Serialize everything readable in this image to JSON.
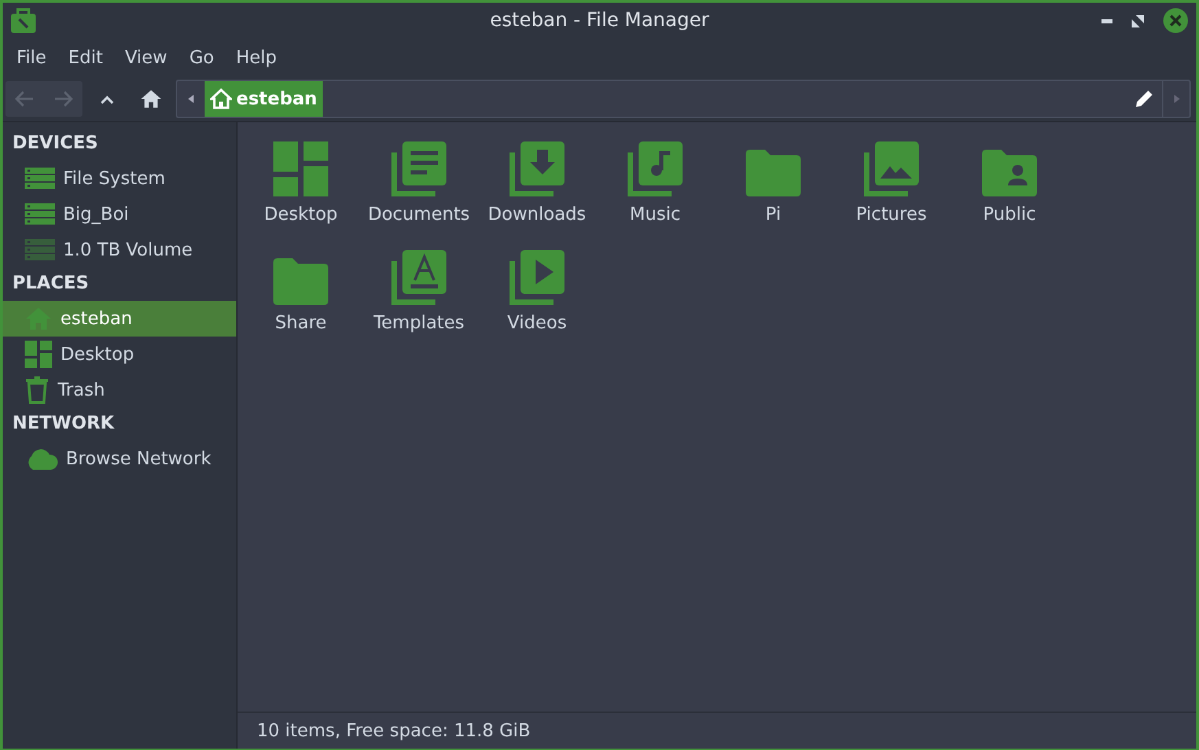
{
  "window": {
    "title": "esteban - File Manager"
  },
  "menu": [
    "File",
    "Edit",
    "View",
    "Go",
    "Help"
  ],
  "toolbar": {
    "back_disabled": true,
    "forward_disabled": true
  },
  "path": {
    "crumbs": [
      {
        "label": "esteban",
        "selected": true
      }
    ]
  },
  "sidebar": {
    "sections": [
      {
        "title": "DEVICES",
        "items": [
          {
            "label": "File System",
            "kind": "drive",
            "mounted": true,
            "selected": false
          },
          {
            "label": "Big_Boi",
            "kind": "drive",
            "mounted": true,
            "selected": false
          },
          {
            "label": "1.0 TB Volume",
            "kind": "drive",
            "mounted": false,
            "selected": false
          }
        ]
      },
      {
        "title": "PLACES",
        "items": [
          {
            "label": "esteban",
            "kind": "home",
            "selected": true
          },
          {
            "label": "Desktop",
            "kind": "desktop",
            "selected": false
          },
          {
            "label": "Trash",
            "kind": "trash",
            "selected": false
          }
        ]
      },
      {
        "title": "NETWORK",
        "items": [
          {
            "label": "Browse Network",
            "kind": "cloud",
            "selected": false
          }
        ]
      }
    ]
  },
  "files": [
    {
      "name": "Desktop",
      "kind": "desktop"
    },
    {
      "name": "Documents",
      "kind": "documents"
    },
    {
      "name": "Downloads",
      "kind": "downloads"
    },
    {
      "name": "Music",
      "kind": "music"
    },
    {
      "name": "Pi",
      "kind": "folder"
    },
    {
      "name": "Pictures",
      "kind": "pictures"
    },
    {
      "name": "Public",
      "kind": "public"
    },
    {
      "name": "Share",
      "kind": "folder"
    },
    {
      "name": "Templates",
      "kind": "templates"
    },
    {
      "name": "Videos",
      "kind": "videos"
    }
  ],
  "status_bar": "10 items, Free space: 11.8 GiB"
}
